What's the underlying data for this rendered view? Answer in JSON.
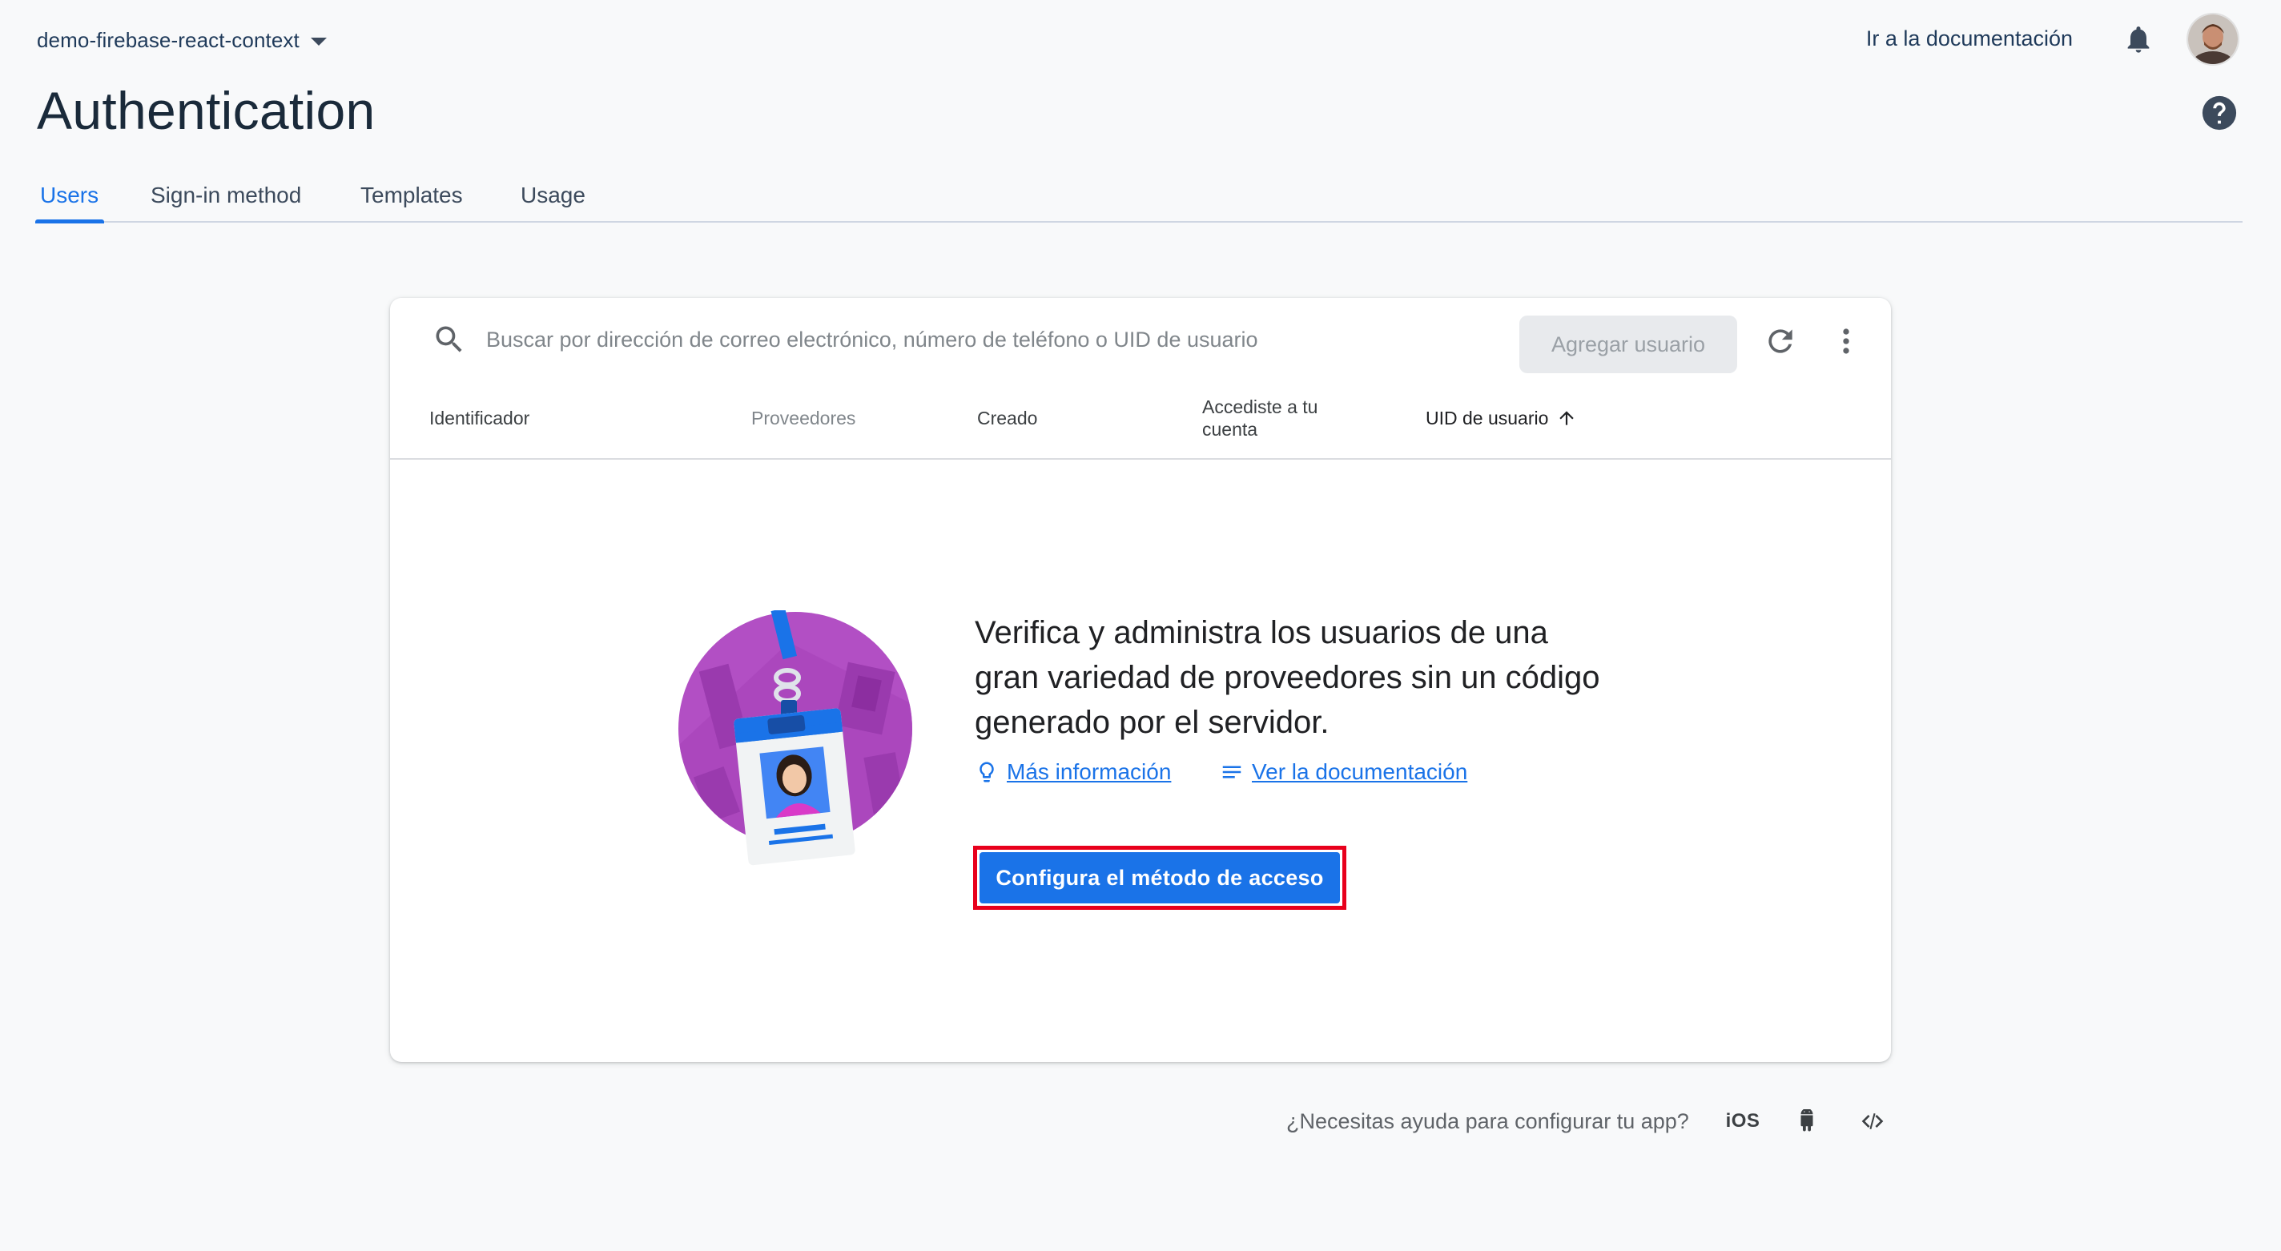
{
  "header": {
    "project_name": "demo-firebase-react-context",
    "docs_link": "Ir a la documentación",
    "page_title": "Authentication"
  },
  "tabs": [
    {
      "label": "Users",
      "active": true
    },
    {
      "label": "Sign-in method",
      "active": false
    },
    {
      "label": "Templates",
      "active": false
    },
    {
      "label": "Usage",
      "active": false
    }
  ],
  "users_table": {
    "search_placeholder": "Buscar por dirección de correo electrónico, número de teléfono o UID de usuario",
    "add_user_label": "Agregar usuario",
    "columns": [
      "Identificador",
      "Proveedores",
      "Creado",
      "Accediste a tu cuenta",
      "UID de usuario"
    ],
    "sorted_column": "UID de usuario",
    "sort_direction": "ascending"
  },
  "empty_state": {
    "message": "Verifica y administra los usuarios de una gran variedad de proveedores sin un código generado por el servidor.",
    "learn_more_link": "Más información",
    "docs_link": "Ver la documentación",
    "cta_button": "Configura el método de acceso"
  },
  "footer": {
    "help_text": "¿Necesitas ayuda para configurar tu app?",
    "platforms": [
      "iOS",
      "android",
      "web"
    ],
    "ios_label": "iOS"
  },
  "colors": {
    "accent": "#1a73e8",
    "highlight_outline": "#e8001c",
    "illustration_purple": "#b24fc4"
  }
}
